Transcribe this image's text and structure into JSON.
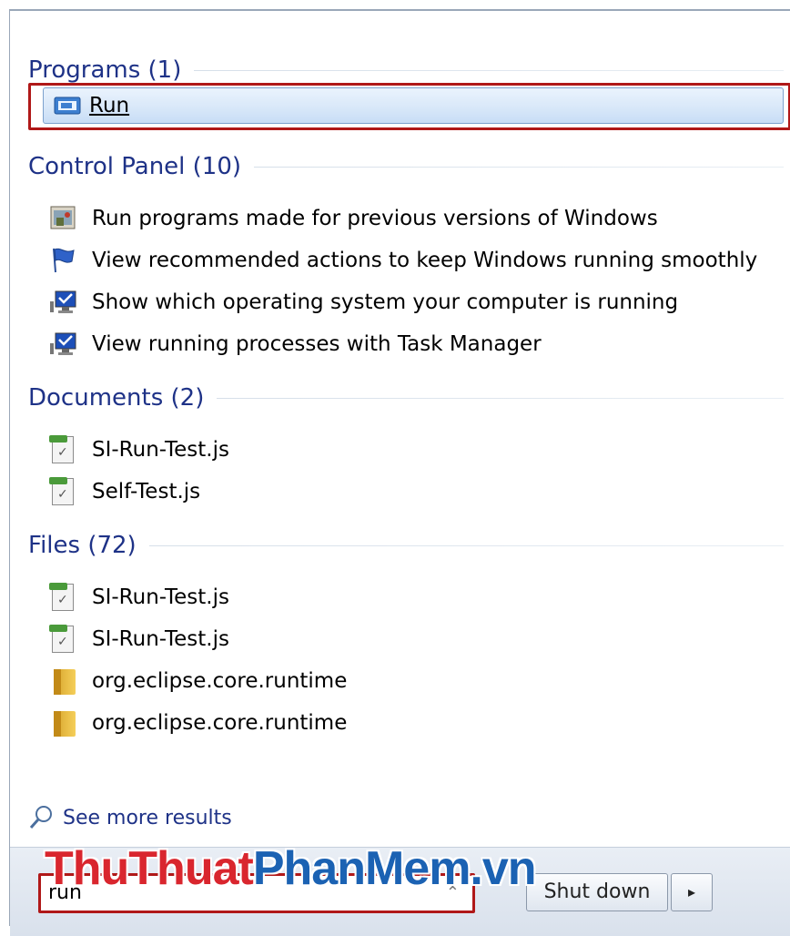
{
  "programs": {
    "header": "Programs (1)",
    "items": [
      {
        "label": "Run",
        "icon": "run-icon"
      }
    ]
  },
  "control_panel": {
    "header": "Control Panel (10)",
    "items": [
      {
        "label": "Run programs made for previous versions of Windows",
        "icon": "compatibility-icon"
      },
      {
        "label": "View recommended actions to keep Windows running smoothly",
        "icon": "action-center-flag-icon"
      },
      {
        "label": "Show which operating system your computer is running",
        "icon": "system-monitor-icon"
      },
      {
        "label": "View running processes with Task Manager",
        "icon": "system-monitor-icon"
      }
    ]
  },
  "documents": {
    "header": "Documents (2)",
    "items": [
      {
        "label": "SI-Run-Test.js",
        "icon": "script-file-icon"
      },
      {
        "label": "Self-Test.js",
        "icon": "script-file-icon"
      }
    ]
  },
  "files": {
    "header": "Files (72)",
    "items": [
      {
        "label": "SI-Run-Test.js",
        "icon": "script-file-icon"
      },
      {
        "label": "SI-Run-Test.js",
        "icon": "script-file-icon"
      },
      {
        "label": "org.eclipse.core.runtime",
        "icon": "folder-icon"
      },
      {
        "label": "org.eclipse.core.runtime",
        "icon": "folder-icon"
      }
    ]
  },
  "see_more": {
    "label": "See more results",
    "icon": "search-icon"
  },
  "search": {
    "value": "run"
  },
  "shutdown": {
    "label": "Shut down",
    "arrow": "▸"
  },
  "watermark": {
    "part1": "ThuThuat",
    "part2": "PhanMem.vn"
  },
  "colors": {
    "header": "#1e3287",
    "highlight_border": "#b01818",
    "selection": "#d9e8f9"
  }
}
